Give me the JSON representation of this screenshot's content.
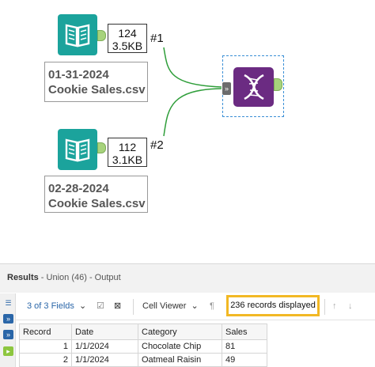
{
  "canvas": {
    "input1": {
      "count": "124",
      "size": "3.5KB",
      "connection_label": "#1",
      "annotation_line1": "01-31-2024",
      "annotation_line2": "Cookie Sales.csv"
    },
    "input2": {
      "count": "112",
      "size": "3.1KB",
      "connection_label": "#2",
      "annotation_line1": "02-28-2024",
      "annotation_line2": "Cookie Sales.csv"
    },
    "union": {
      "input_anchor_glyph": "»"
    }
  },
  "results": {
    "header_title": "Results",
    "header_subtitle": " - Union (46) - Output",
    "toolbar": {
      "fields_label": "3 of 3 Fields",
      "viewer_label": "Cell Viewer",
      "pilcrow": "¶",
      "records_displayed": "236 records displayed",
      "up_arrow": "↑",
      "down_arrow": "↓"
    },
    "columns": [
      "Record",
      "Date",
      "Category",
      "Sales"
    ],
    "rows": [
      {
        "record": "1",
        "date": "1/1/2024",
        "category": "Chocolate Chip",
        "sales": "81"
      },
      {
        "record": "2",
        "date": "1/1/2024",
        "category": "Oatmeal Raisin",
        "sales": "49"
      }
    ]
  },
  "colors": {
    "input_tool": "#1ba39c",
    "union_tool": "#6b2b82",
    "anchor_green": "#a7d37c",
    "connection_green": "#2f9e3a",
    "highlight": "#f2b824",
    "selection": "#3a8fd6"
  }
}
